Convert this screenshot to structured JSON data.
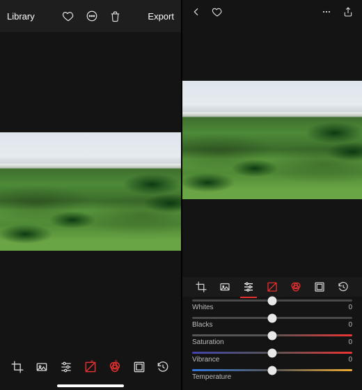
{
  "left": {
    "library": "Library",
    "export": "Export"
  },
  "sliders": {
    "whites": {
      "label": "Whites",
      "value": "0"
    },
    "blacks": {
      "label": "Blacks",
      "value": "0"
    },
    "saturation": {
      "label": "Saturation",
      "value": "0"
    },
    "vibrance": {
      "label": "Vibrance",
      "value": "0"
    },
    "temperature": {
      "label": "Temperature",
      "value": "0"
    }
  },
  "toolbar_icons": [
    "crop",
    "format",
    "adjust",
    "curves",
    "color",
    "presets",
    "history"
  ]
}
